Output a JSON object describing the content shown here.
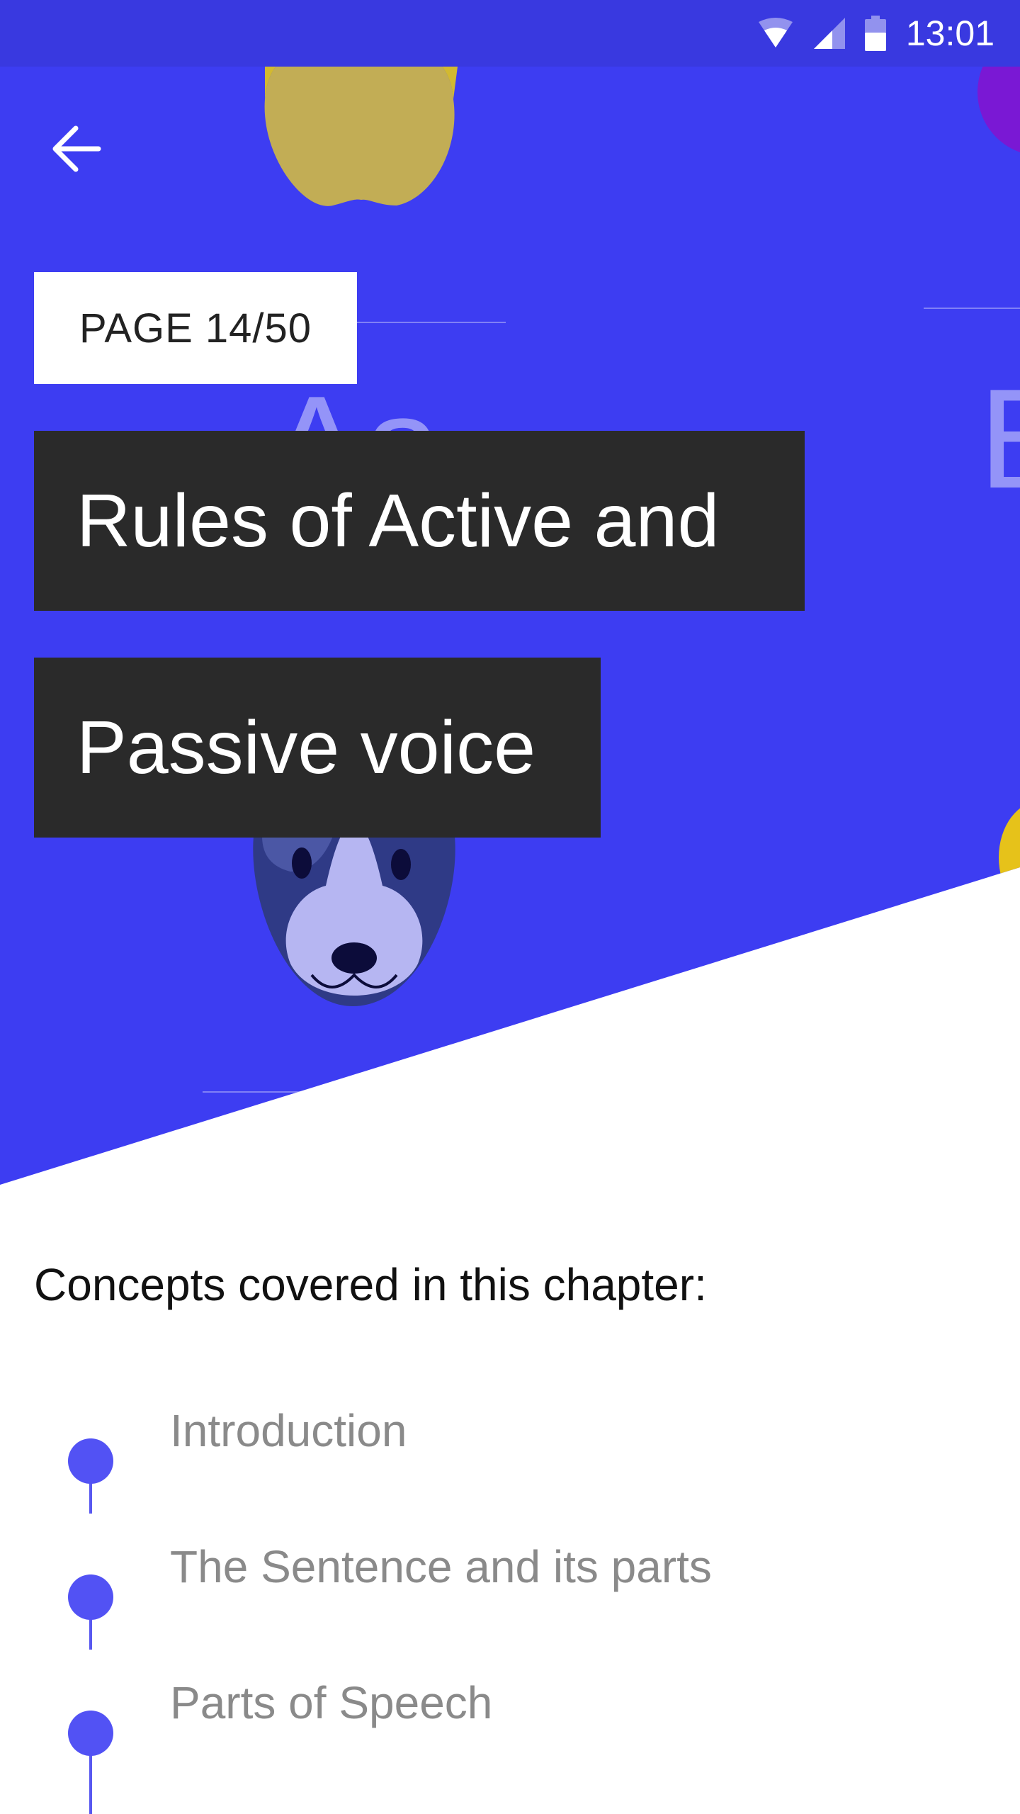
{
  "status_bar": {
    "time": "13:01"
  },
  "header": {
    "page_indicator": "PAGE 14/50",
    "title_line_1": "Rules of Active and",
    "title_line_2": "Passive voice",
    "background_color": "#3d3df2"
  },
  "decor": {
    "letters_left": "Aa",
    "letter_right": "B"
  },
  "concepts": {
    "heading": "Concepts covered in this chapter:",
    "items": [
      {
        "label": "Introduction"
      },
      {
        "label": "The Sentence and its parts"
      },
      {
        "label": "Parts of Speech"
      }
    ],
    "accent_color": "#5252f4"
  }
}
